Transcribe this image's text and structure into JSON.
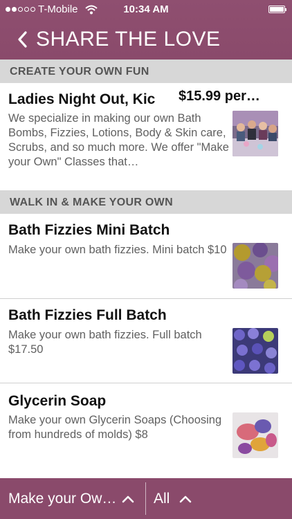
{
  "status": {
    "carrier": "T-Mobile",
    "time": "10:34 AM"
  },
  "nav": {
    "title": "SHARE THE LOVE"
  },
  "sections": [
    {
      "header": "CREATE YOUR OWN FUN",
      "items": [
        {
          "title": "Ladies Night Out, Kic",
          "price": "$15.99 per…",
          "description": "We specialize in making our own Bath Bombs, Fizzies, Lotions, Body & Skin care, Scrubs, and so much more.  We offer \"Make your Own\" Classes that…",
          "image": "group-class-photo"
        }
      ]
    },
    {
      "header": "WALK IN & MAKE YOUR OWN",
      "items": [
        {
          "title": "Bath Fizzies Mini Batch",
          "description": "Make your own bath fizzies.  Mini batch $10",
          "image": "bath-fizzies-photo"
        },
        {
          "title": "Bath Fizzies Full Batch",
          "description": "Make your own bath fizzies.  Full batch $17.50",
          "image": "bath-fizzies-tray-photo"
        },
        {
          "title": "Glycerin Soap",
          "description": "Make your own Glycerin Soaps (Choosing from hundreds of molds) $8",
          "image": "glycerin-soap-photo"
        }
      ]
    }
  ],
  "bottom_bar": {
    "left_label": "Make your Ow…",
    "right_label": "All"
  },
  "colors": {
    "brand": "#8a4a6b",
    "section_bg": "#d7d7d7"
  }
}
